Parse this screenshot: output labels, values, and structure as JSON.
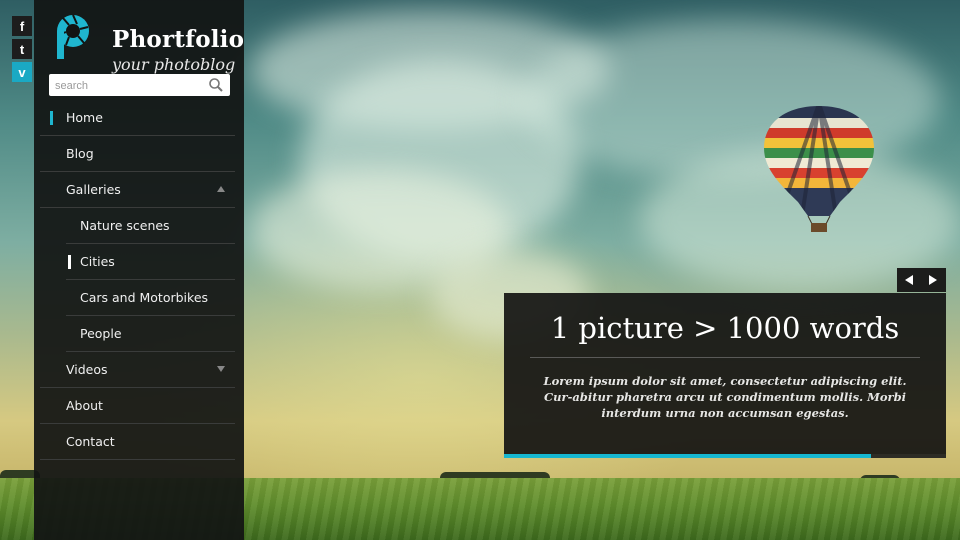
{
  "social": [
    {
      "id": "facebook",
      "glyph": "f",
      "icon": "facebook-icon"
    },
    {
      "id": "tumblr",
      "glyph": "t",
      "icon": "tumblr-icon"
    },
    {
      "id": "vimeo",
      "glyph": "v",
      "icon": "vimeo-icon"
    }
  ],
  "brand": {
    "title": "Phortfolio",
    "subtitle": "your photoblog",
    "accent": "#1fb6cf"
  },
  "search": {
    "placeholder": "search",
    "value": ""
  },
  "nav": {
    "home": "Home",
    "blog": "Blog",
    "galleries": "Galleries",
    "galleries_children": {
      "nature": "Nature scenes",
      "cities": "Cities",
      "cars": "Cars and Motorbikes",
      "people": "People"
    },
    "videos": "Videos",
    "about": "About",
    "contact": "Contact",
    "active": "Home",
    "active_sub": "Cities"
  },
  "slider": {
    "title": "1 picture > 1000 words",
    "text": "Lorem ipsum dolor sit amet, consectetur adipiscing elit. Cur-abitur pharetra arcu ut condimentum mollis. Morbi interdum urna non accumsan egestas.",
    "progress": 0.83,
    "progress_color": "#16b7d0"
  }
}
